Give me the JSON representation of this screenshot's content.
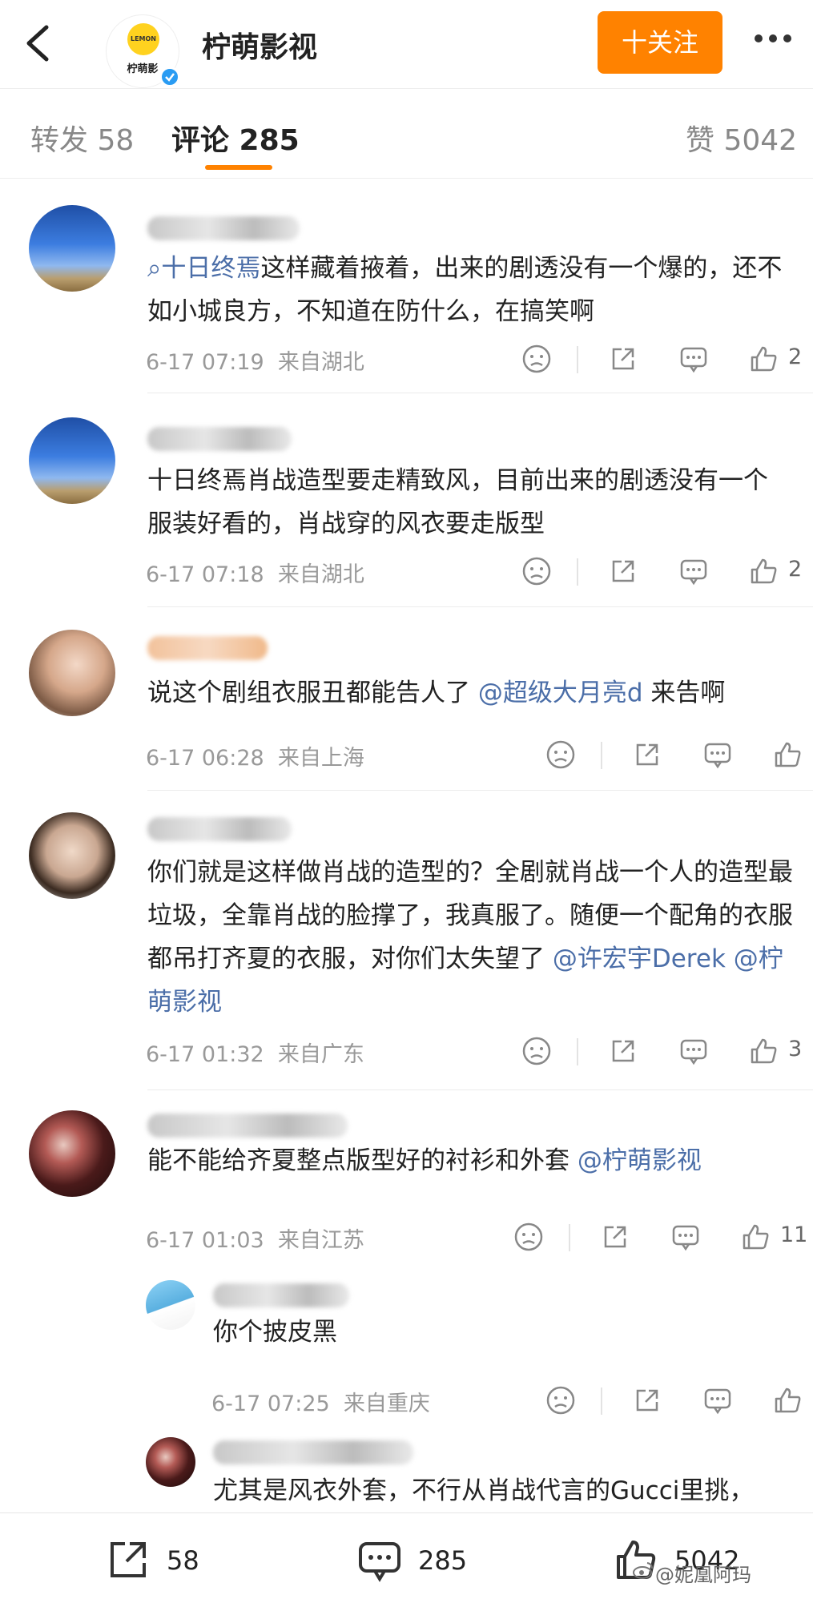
{
  "header": {
    "account_name": "柠萌影视",
    "logo_lemon_text": "LEMON",
    "logo_caption": "柠萌影",
    "follow_label": "十关注"
  },
  "tabs": {
    "repost": "转发 58",
    "comments": "评论 285",
    "likes": "赞 5042"
  },
  "comments": [
    {
      "text_prefix": "",
      "text_link_1": "十日终焉",
      "text_main": "这样藏着掖着，出来的剧透没有一个爆的，还不如小城良方，不知道在防什么，在搞笑啊",
      "time": "6-17 07:19",
      "location": "来自湖北",
      "likes": "2"
    },
    {
      "text_main": "十日终焉肖战造型要走精致风，目前出来的剧透没有一个服装好看的，肖战穿的风衣要走版型",
      "time": "6-17 07:18",
      "location": "来自湖北",
      "likes": "2"
    },
    {
      "text_main": "说这个剧组衣服丑都能告人了",
      "text_link_1": "@超级大月亮d",
      "text_after": " 来告啊",
      "time": "6-17 06:28",
      "location": "来自上海",
      "likes": ""
    },
    {
      "text_main": "你们就是这样做肖战的造型的？全剧就肖战一个人的造型最垃圾，全靠肖战的脸撑了，我真服了。随便一个配角的衣服都吊打齐夏的衣服，对你们太失望了",
      "text_link_1": "@许宏宇Derek",
      "text_link_2": "@柠萌影视",
      "time": "6-17 01:32",
      "location": "来自广东",
      "likes": "3"
    },
    {
      "text_main": "能不能给齐夏整点版型好的衬衫和外套",
      "text_link_1": "@柠萌影视",
      "time": "6-17 01:03",
      "location": "来自江苏",
      "likes": "11"
    }
  ],
  "replies": [
    {
      "text_main": "你个披皮黑",
      "time": "6-17 07:25",
      "location": "来自重庆",
      "likes": ""
    },
    {
      "text_main": "尤其是风衣外套，不行从肖战代言的Gucci里挑，"
    }
  ],
  "bottom_bar": {
    "repost_count": "58",
    "comment_count": "285",
    "like_count": "5042"
  },
  "watermark": "@妮凰阿玛"
}
